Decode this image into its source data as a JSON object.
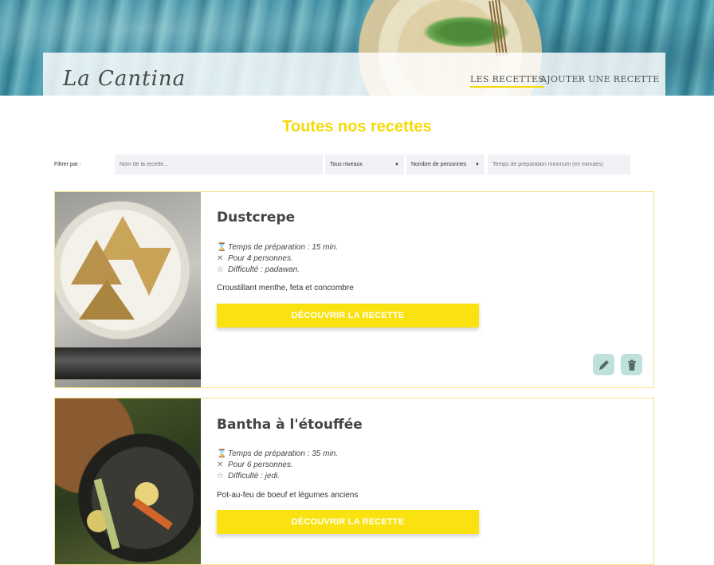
{
  "header": {
    "logo": "La Cantina",
    "nav": [
      {
        "label": "LES RECETTES",
        "active": true
      },
      {
        "label": "AJOUTER UNE RECETTE",
        "active": false
      }
    ]
  },
  "main": {
    "title": "Toutes nos recettes"
  },
  "filters": {
    "label": "Filtrer par :",
    "name_placeholder": "Nom de la recette...",
    "level_select": "Tous niveaux",
    "people_select": "Nombre de personnes",
    "time_placeholder": "Temps de préparation minimum (en minutes)"
  },
  "recipes": [
    {
      "title": "Dustcrepe",
      "prep": "Temps de préparation : 15 min.",
      "people": "Pour 4 personnes.",
      "difficulty": "Difficulté : padawan.",
      "description": "Croustillant menthe, feta et concombre",
      "cta": "DÉCOUVRIR LA RECETTE"
    },
    {
      "title": "Bantha à l'étouffée",
      "prep": "Temps de préparation : 35 min.",
      "people": "Pour 6 personnes.",
      "difficulty": "Difficulté : jedi.",
      "description": "Pot-au-feu de boeuf et légumes anciens",
      "cta": "DÉCOUVRIR LA RECETTE"
    }
  ],
  "colors": {
    "accent": "#f9e20f",
    "action_button_bg": "#bfe1dc"
  },
  "icons": {
    "prep": "hourglass-icon",
    "people": "utensils-icon",
    "difficulty": "star-icon",
    "edit": "pencil-icon",
    "delete": "trash-icon"
  }
}
